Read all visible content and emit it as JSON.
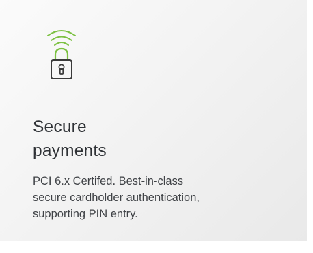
{
  "card": {
    "icon": "wireless-lock-icon",
    "title_line1": "Secure",
    "title_line2": "payments",
    "description_line1": "PCI 6.x Certifed. Best-in-class",
    "description_line2": "secure cardholder authentication,",
    "description_line3": "supporting PIN entry."
  },
  "colors": {
    "accent": "#7cc142",
    "outline": "#3a3a3a",
    "text": "#2f3236"
  }
}
